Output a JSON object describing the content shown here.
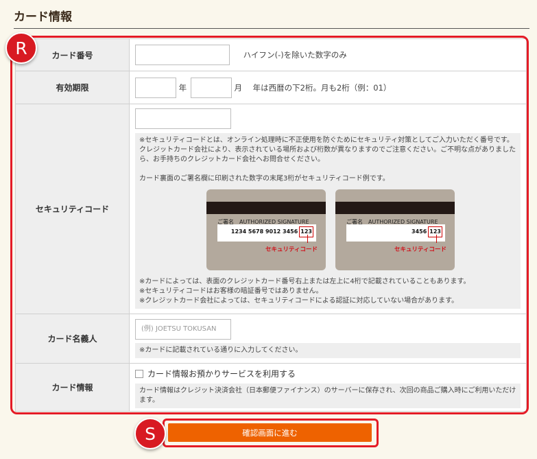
{
  "section_title": "カード情報",
  "rows": {
    "card_number": {
      "label": "カード番号",
      "input_value": "",
      "hint": "ハイフン(-)を除いた数字のみ"
    },
    "expiry": {
      "label": "有効期限",
      "year_value": "",
      "year_unit": "年",
      "month_value": "",
      "month_unit": "月",
      "hint": "年は西暦の下2桁。月も2桁（例：01）"
    },
    "security_code": {
      "label": "セキュリティコード",
      "input_value": "",
      "note_1": "※セキュリティコードとは、オンライン処理時に不正使用を防ぐためにセキュリティ対策としてご入力いただく番号です。クレジットカード会社により、表示されている場所および桁数が異なりますのでご注意ください。ご不明な点がありましたら、お手持ちのクレジットカード会社へお問合せください。",
      "note_2": "カード裏面のご署名欄に印刷された数字の末尾3桁がセキュリティコード例です。",
      "card_left": {
        "sig_label": "ご署名　AUTHORIZED SIGNATURE",
        "number_prefix": "1234  5678  9012  3456",
        "code": "123",
        "pointer_label": "セキュリティコード"
      },
      "card_right": {
        "sig_label": "ご署名　AUTHORIZED SIGNATURE",
        "number_prefix": "3456",
        "code": "123",
        "pointer_label": "セキュリティコード"
      },
      "note_3": "※カードによっては、表面のクレジットカード番号右上または左上に4桁で記載されていることもあります。",
      "note_4": "※セキュリティコードはお客様の暗証番号ではありません。",
      "note_5": "※クレジットカード会社によっては、セキュリティコードによる認証に対応していない場合があります。"
    },
    "holder": {
      "label": "カード名義人",
      "placeholder": "(例) JOETSU TOKUSAN",
      "note": "※カードに記載されている通りに入力してください。"
    },
    "card_info": {
      "label": "カード情報",
      "checkbox_label": "カード情報お預かりサービスを利用する",
      "checkbox_checked": false,
      "note": "カード情報はクレジット決済会社（日本郵便ファイナンス）のサーバーに保存され、次回の商品ご購入時にご利用いただけます。"
    }
  },
  "submit_button": "確認画面に進む",
  "markers": {
    "r": "R",
    "s": "S"
  },
  "colors": {
    "submit": "#ee6200",
    "highlight": "#e41b26",
    "header_cell": "#eeeeee",
    "background": "#faf7ec"
  }
}
